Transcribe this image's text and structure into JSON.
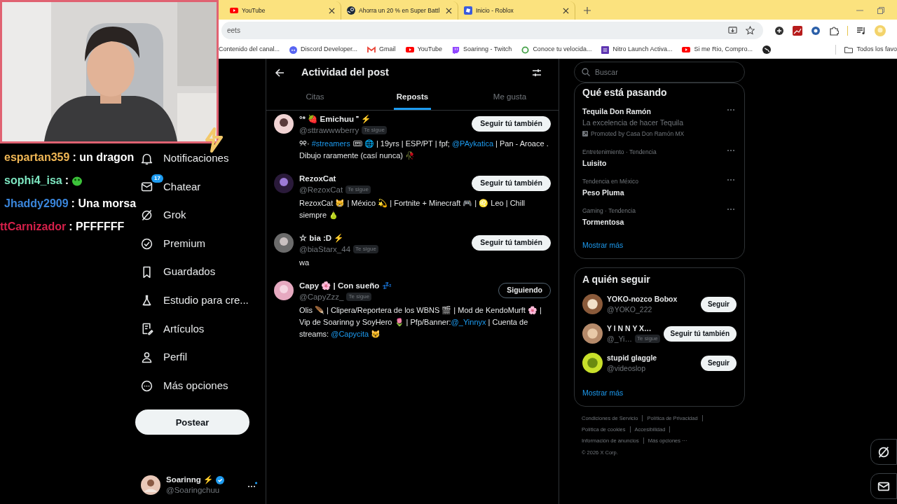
{
  "browser": {
    "tabs": [
      {
        "title": "YouTube",
        "selected": false
      },
      {
        "title": "Ahorra un 20 % en Super Battl",
        "selected": false
      },
      {
        "title": "Inicio - Roblox",
        "selected": false
      }
    ],
    "address": "eets",
    "bookmarks": [
      "Contenido del canal...",
      "Discord Developer...",
      "Gmail",
      "YouTube",
      "Soarinng - Twitch",
      "Conoce tu velocida...",
      "Nitro Launch Activa...",
      "Si me Rio, Compro..."
    ],
    "all_bookmarks": "Todos los favo"
  },
  "chat_overlay": [
    {
      "user": "espartan359",
      "color": "#f0b755",
      "message": ": un dragon",
      "emote": false
    },
    {
      "user": "sophi4_isa",
      "color": "#7de6c0",
      "message": ":",
      "emote": true
    },
    {
      "user": "Jhaddy2909",
      "color": "#3a86dc",
      "message": ": Una morsa",
      "emote": false
    },
    {
      "user": "ttCarnizador",
      "color": "#d6204a",
      "message": ": PFFFFFF",
      "emote": false
    }
  ],
  "sidebar": {
    "items": [
      {
        "label": "Notificaciones"
      },
      {
        "label": "Chatear",
        "badge": "17"
      },
      {
        "label": "Grok"
      },
      {
        "label": "Premium"
      },
      {
        "label": "Guardados"
      },
      {
        "label": "Estudio para cre..."
      },
      {
        "label": "Artículos"
      },
      {
        "label": "Perfil"
      },
      {
        "label": "Más opciones"
      }
    ],
    "post_button": "Postear",
    "account": {
      "name": "Soarinng ⚡",
      "handle": "@Soaringchuu",
      "verified": true
    }
  },
  "main": {
    "title": "Actividad del post",
    "tabs": [
      {
        "label": "Citas",
        "selected": false
      },
      {
        "label": "Reposts",
        "selected": true
      },
      {
        "label": "Me gusta",
        "selected": false
      }
    ],
    "users": [
      {
        "name": "°* 🍓 Emichuu ⁼ ⚡",
        "handle": "@sttrawwwberry",
        "follows_you": "Te sigue",
        "button": "Seguir tú también",
        "following": false,
        "bio": [
          {
            "kind": "text",
            "text": "୨୧· "
          },
          {
            "kind": "link",
            "text": "#streamers"
          },
          {
            "kind": "text",
            "text": " 🎟 🌐 | 19yrs | ESP/PT | fpf; "
          },
          {
            "kind": "link",
            "text": "@PAykatica"
          },
          {
            "kind": "text",
            "text": " | Pan - Aroace . Dibujo raramente (casí nunca) 🥀"
          }
        ]
      },
      {
        "name": "RezoxCat",
        "handle": "@RezoxCat",
        "follows_you": "Te sigue",
        "button": "Seguir tú también",
        "following": false,
        "bio": [
          {
            "kind": "text",
            "text": "RezoxCat 😸 | México 💫 | Fortnite + Minecraft 🎮 | ♌ Leo | Chill siempre 🍐"
          }
        ]
      },
      {
        "name": "☆ bia :D ⚡",
        "handle": "@biaStarx_44",
        "follows_you": "Te sigue",
        "button": "Seguir tú también",
        "following": false,
        "bio": [
          {
            "kind": "text",
            "text": "wa"
          }
        ]
      },
      {
        "name": "Capy 🌸 | Con sueño 💤",
        "handle": "@CapyZzz_",
        "follows_you": "Te sigue",
        "button": "Siguiendo",
        "following": true,
        "bio": [
          {
            "kind": "text",
            "text": "Olis 🪶 | Clipera/Reportera de los WBNS 🎬 | Mod de KendoMurft 🌸 | Vip de Soarinng y SoyHero 🌷 | Pfp/Banner:"
          },
          {
            "kind": "link",
            "text": "@_Yinnyx"
          },
          {
            "kind": "text",
            "text": " | Cuenta de streams: "
          },
          {
            "kind": "link",
            "text": "@Capycita"
          },
          {
            "kind": "text",
            "text": " 😺"
          }
        ]
      }
    ]
  },
  "right": {
    "search": {
      "placeholder": "Buscar"
    },
    "trends": {
      "heading": "Qué está pasando",
      "items": [
        {
          "kind": "promoted",
          "title": "Tequila Don Ramón",
          "description": "La excelencia de hacer Tequila",
          "promoted": "Promoted by Casa Don Ramón MX"
        },
        {
          "kind": "trend",
          "context": "Entretenimiento · Tendencia",
          "title": "Luisito"
        },
        {
          "kind": "trend",
          "context": "Tendencia en México",
          "title": "Peso Pluma"
        },
        {
          "kind": "trend",
          "context": "Gaming · Tendencia",
          "title": "Tormentosa"
        }
      ],
      "show_more": "Mostrar más"
    },
    "who_to_follow": {
      "heading": "A quién seguir",
      "users": [
        {
          "name": "YOKO-nozco Bobox",
          "handle": "@YOKO_222",
          "button": "Seguir"
        },
        {
          "name": "Y I N N Y X…",
          "handle": "@_Yi…",
          "follows_you": "Te sigue",
          "button": "Seguir tú también"
        },
        {
          "name": "stupid glaggle",
          "handle": "@videoslop",
          "button": "Seguir"
        }
      ],
      "show_more": "Mostrar más"
    },
    "footer": [
      "Condiciones de Servicio",
      "Política de Privacidad",
      "Política de cookies",
      "Accesibilidad",
      "Información de anuncios",
      "Más opciones ···"
    ],
    "copyright": "© 2026 X Corp."
  }
}
